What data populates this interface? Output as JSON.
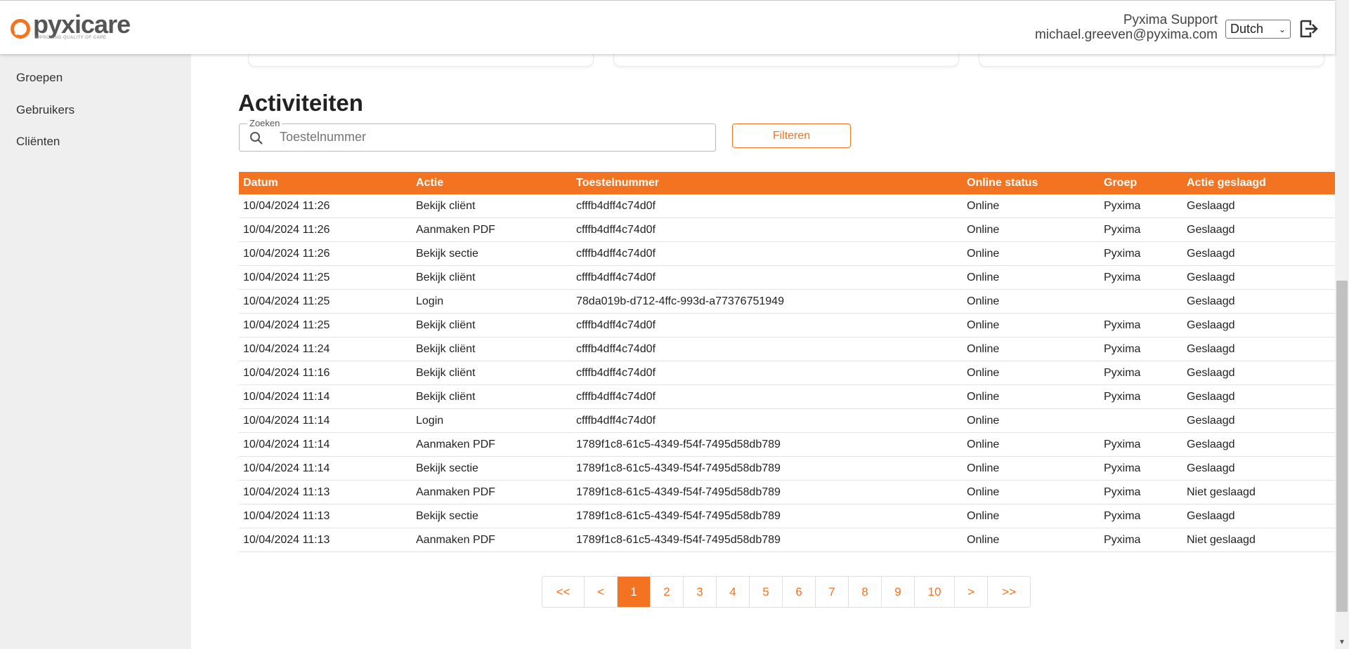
{
  "app": {
    "logo_text": "pyxicare",
    "logo_tagline": "IMPROVING QUALITY OF CARE"
  },
  "header": {
    "user_name": "Pyxima Support",
    "user_email": "michael.greeven@pyxima.com",
    "language": "Dutch",
    "logout_icon": "logout-icon"
  },
  "sidebar": {
    "items": [
      {
        "label": "Groepen"
      },
      {
        "label": "Gebruikers"
      },
      {
        "label": "Cliënten"
      }
    ]
  },
  "main": {
    "title": "Activiteiten",
    "search": {
      "legend": "Zoeken",
      "placeholder": "Toestelnummer"
    },
    "filter_label": "Filteren"
  },
  "table": {
    "headers": [
      "Datum",
      "Actie",
      "Toestelnummer",
      "Online status",
      "Groep",
      "Actie geslaagd"
    ],
    "rows": [
      [
        "10/04/2024 11:26",
        "Bekijk cliënt",
        "cfffb4dff4c74d0f",
        "Online",
        "Pyxima",
        "Geslaagd"
      ],
      [
        "10/04/2024 11:26",
        "Aanmaken PDF",
        "cfffb4dff4c74d0f",
        "Online",
        "Pyxima",
        "Geslaagd"
      ],
      [
        "10/04/2024 11:26",
        "Bekijk sectie",
        "cfffb4dff4c74d0f",
        "Online",
        "Pyxima",
        "Geslaagd"
      ],
      [
        "10/04/2024 11:25",
        "Bekijk cliënt",
        "cfffb4dff4c74d0f",
        "Online",
        "Pyxima",
        "Geslaagd"
      ],
      [
        "10/04/2024 11:25",
        "Login",
        "78da019b-d712-4ffc-993d-a77376751949",
        "Online",
        "",
        "Geslaagd"
      ],
      [
        "10/04/2024 11:25",
        "Bekijk cliënt",
        "cfffb4dff4c74d0f",
        "Online",
        "Pyxima",
        "Geslaagd"
      ],
      [
        "10/04/2024 11:24",
        "Bekijk cliënt",
        "cfffb4dff4c74d0f",
        "Online",
        "Pyxima",
        "Geslaagd"
      ],
      [
        "10/04/2024 11:16",
        "Bekijk cliënt",
        "cfffb4dff4c74d0f",
        "Online",
        "Pyxima",
        "Geslaagd"
      ],
      [
        "10/04/2024 11:14",
        "Bekijk cliënt",
        "cfffb4dff4c74d0f",
        "Online",
        "Pyxima",
        "Geslaagd"
      ],
      [
        "10/04/2024 11:14",
        "Login",
        "cfffb4dff4c74d0f",
        "Online",
        "",
        "Geslaagd"
      ],
      [
        "10/04/2024 11:14",
        "Aanmaken PDF",
        "1789f1c8-61c5-4349-f54f-7495d58db789",
        "Online",
        "Pyxima",
        "Geslaagd"
      ],
      [
        "10/04/2024 11:14",
        "Bekijk sectie",
        "1789f1c8-61c5-4349-f54f-7495d58db789",
        "Online",
        "Pyxima",
        "Geslaagd"
      ],
      [
        "10/04/2024 11:13",
        "Aanmaken PDF",
        "1789f1c8-61c5-4349-f54f-7495d58db789",
        "Online",
        "Pyxima",
        "Niet geslaagd"
      ],
      [
        "10/04/2024 11:13",
        "Bekijk sectie",
        "1789f1c8-61c5-4349-f54f-7495d58db789",
        "Online",
        "Pyxima",
        "Geslaagd"
      ],
      [
        "10/04/2024 11:13",
        "Aanmaken PDF",
        "1789f1c8-61c5-4349-f54f-7495d58db789",
        "Online",
        "Pyxima",
        "Niet geslaagd"
      ]
    ]
  },
  "pagination": {
    "pages": [
      "<<",
      "<",
      "1",
      "2",
      "3",
      "4",
      "5",
      "6",
      "7",
      "8",
      "9",
      "10",
      ">",
      ">>"
    ],
    "current": "1"
  },
  "colors": {
    "accent": "#f47321",
    "sidebar_bg": "#efefef"
  }
}
